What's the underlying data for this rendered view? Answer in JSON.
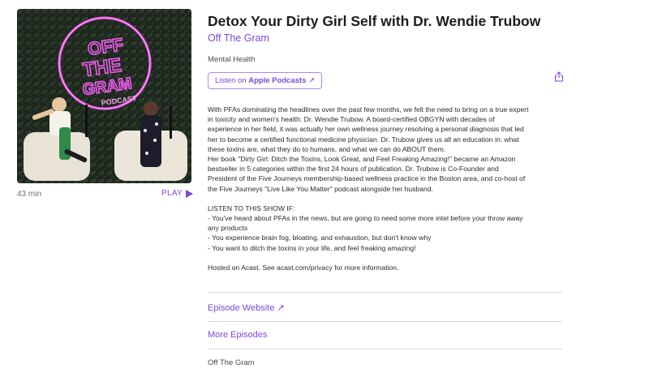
{
  "episode": {
    "title": "Detox Your Dirty Girl Self with Dr. Wendie Trubow",
    "show": "Off The Gram",
    "category": "Mental Health",
    "duration": "43 min",
    "play_label": "PLAY"
  },
  "artwork": {
    "line1": "OFF",
    "line2": "THE",
    "line3": "GRAM",
    "line4": "PODCAST",
    "neon_color": "#e33fe0"
  },
  "actions": {
    "listen_prefix": "Listen on ",
    "listen_brand": "Apple Podcasts",
    "listen_arrow": "↗"
  },
  "description": {
    "lines": [
      "With PFAs dominating the headlines over the past few months, we felt the need to bring on a true expert",
      "in toxicity and women's health: Dr. Wendie Trubow.  A board-certified OBGYN with decades of",
      "experience in her field, it was actually her own wellness journey resolving a personal diagnosis that led",
      "her to become a certified functional medicine physician.  Dr. Trubow gives us all an education in: what",
      "these toxins are, what they do to humans, and what we can do ABOUT them.",
      "Her book \"Dirty Girl: Ditch the Toxins, Look Great, and Feel Freaking Amazing!\" became an Amazon",
      "bestseller in 5 categories within the first 24 hours of publication. Dr. Trubow is Co-Founder and",
      "President of the Five Journeys membership-based wellness practice in the Boston area, and co-host of",
      "the Five Journeys \"Live Like You Matter\" podcast alongside her husband.",
      "",
      "LISTEN TO THIS SHOW IF:",
      "- You've heard about PFAs in the news, but are going to need some more intel before your throw away",
      "any products",
      "- You experience brain fog, bloating, and exhaustion, but don't know why",
      "- You want to ditch the toxins in your life, and feel freaking amazing!",
      "",
      "Hosted on Acast. See acast.com/privacy for more information."
    ]
  },
  "links": {
    "episode_website": "Episode Website ↗",
    "more_episodes": "More Episodes"
  },
  "footer": {
    "show": "Off The Gram"
  },
  "colors": {
    "accent": "#7b4ad6",
    "text": "#1d1d1f",
    "muted": "#6e6e73"
  }
}
